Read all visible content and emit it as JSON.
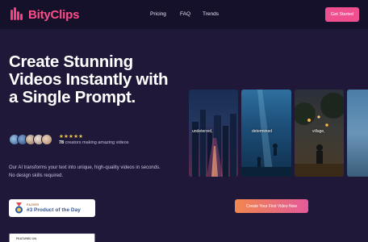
{
  "header": {
    "brand": "BityClips",
    "nav": [
      "Pricing",
      "FAQ",
      "Trends"
    ],
    "cta": "Get Started"
  },
  "hero": {
    "headline": "Create Stunning Videos Instantly with a Single Prompt.",
    "rating_stars": "★★★★★",
    "creators_count": "78",
    "creators_text": "creators making amazing videos",
    "description": "Our AI transforms your text into unique, high-quality videos in seconds. No design skills required.",
    "badge_small": "FAZIER",
    "badge_big": "#3 Product of the Day",
    "badge2_small": "FEATURED ON",
    "rating": 5
  },
  "videos": [
    {
      "caption": "undeterred,"
    },
    {
      "caption": "determined"
    },
    {
      "caption": "village,"
    }
  ],
  "cta_main": "Create Your First Video Now",
  "colors": {
    "accent": "#ef4f8f",
    "background": "#1f1838",
    "header": "#16112a",
    "star": "#f2c94c"
  }
}
